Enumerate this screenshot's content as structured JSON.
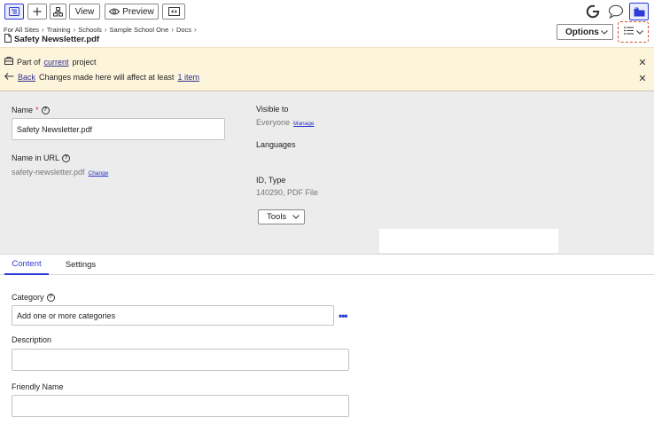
{
  "toolbar": {
    "view_label": "View",
    "preview_label": "Preview",
    "options_label": "Options"
  },
  "breadcrumb": {
    "items": [
      "For All Sites",
      "Training",
      "Schools",
      "Sample School One",
      "Docs"
    ]
  },
  "file_title": "Safety Newsletter.pdf",
  "banner": {
    "part_of_prefix": "Part of",
    "part_of_link": "current",
    "part_of_suffix": "project",
    "back_label": "Back",
    "changes_text": "Changes made here will affect at least",
    "changes_link": "1 item"
  },
  "props": {
    "name_label": "Name",
    "name_required": "*",
    "name_value": "Safety Newsletter.pdf",
    "url_label": "Name in URL",
    "url_value": "safety-newsletter.pdf",
    "url_change": "Change",
    "visible_label": "Visible to",
    "visible_value": "Everyone",
    "visible_manage": "Manage",
    "languages_label": "Languages",
    "id_label": "ID, Type",
    "id_value": "140290, PDF File",
    "tools_label": "Tools"
  },
  "tabs": [
    {
      "label": "Content",
      "active": true
    },
    {
      "label": "Settings",
      "active": false
    }
  ],
  "content": {
    "category_label": "Category",
    "category_placeholder": "Add one or more categories",
    "description_label": "Description",
    "description_value": "",
    "friendly_label": "Friendly Name",
    "friendly_value": ""
  },
  "colors": {
    "accent": "#2d3bd6",
    "banner_bg": "#fdf4dc",
    "props_bg": "#ececec",
    "highlight_dashed": "#d24a2e"
  }
}
